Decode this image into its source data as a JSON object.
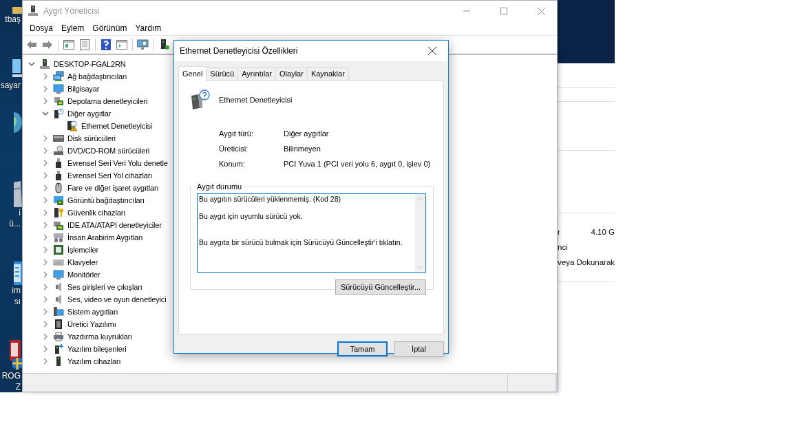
{
  "desktop": {
    "icons": [
      {
        "kind": "folder",
        "lines": [
          "tbaş"
        ]
      },
      {
        "kind": "computer",
        "lines": [
          "sayar"
        ]
      },
      {
        "kind": "globe"
      },
      {
        "kind": "bin",
        "lines": [
          "i",
          "ü..."
        ]
      },
      {
        "kind": "document",
        "lines": [
          "im",
          "sı"
        ]
      },
      {
        "kind": "app",
        "lines": [
          "ROG",
          "Z"
        ]
      }
    ]
  },
  "device_manager": {
    "title": "Aygıt Yöneticisi",
    "menu": [
      "Dosya",
      "Eylem",
      "Görünüm",
      "Yardım"
    ],
    "toolbar": [
      {
        "kind": "back"
      },
      {
        "kind": "forward"
      },
      {
        "kind": "separator"
      },
      {
        "kind": "console"
      },
      {
        "kind": "sheet"
      },
      {
        "kind": "separator"
      },
      {
        "kind": "help"
      },
      {
        "kind": "pane"
      },
      {
        "kind": "separator"
      },
      {
        "kind": "scan"
      },
      {
        "kind": "separator"
      },
      {
        "kind": "add"
      }
    ],
    "tree": [
      {
        "label": "DESKTOP-FGAL2RN",
        "kind": "computer",
        "expanded": true,
        "children": [
          {
            "label": "Ağ bağdaştırıcıları",
            "kind": "network",
            "expanded": false
          },
          {
            "label": "Bilgisayar",
            "kind": "monitor",
            "expanded": false
          },
          {
            "label": "Depolama denetleyicileri",
            "kind": "storage",
            "expanded": false
          },
          {
            "label": "Diğer aygıtlar",
            "kind": "unknown",
            "expanded": true,
            "children": [
              {
                "label": "Ethernet Denetleyicisi",
                "kind": "warning"
              }
            ]
          },
          {
            "label": "Disk sürücüleri",
            "kind": "disk",
            "expanded": false
          },
          {
            "label": "DVD/CD-ROM sürücüleri",
            "kind": "dvd",
            "expanded": false
          },
          {
            "label": "Evrensel Seri Veri Yolu denetle",
            "kind": "usb",
            "expanded": false
          },
          {
            "label": "Evrensel Seri Yol cihazları",
            "kind": "usb",
            "expanded": false
          },
          {
            "label": "Fare ve diğer işaret aygıtları",
            "kind": "mouse",
            "expanded": false
          },
          {
            "label": "Görüntü bağdaştırıcıları",
            "kind": "display",
            "expanded": false
          },
          {
            "label": "Güvenlik cihazları",
            "kind": "security",
            "expanded": false
          },
          {
            "label": "IDE ATA/ATAPI denetleyiciler",
            "kind": "ide",
            "expanded": false
          },
          {
            "label": "İnsan Arabirim Aygıtları",
            "kind": "hid",
            "expanded": false
          },
          {
            "label": "İşlemciler",
            "kind": "cpu",
            "expanded": false
          },
          {
            "label": "Klavyeler",
            "kind": "keyboard",
            "expanded": false
          },
          {
            "label": "Monitörler",
            "kind": "monitor",
            "expanded": false
          },
          {
            "label": "Ses girişleri ve çıkışları",
            "kind": "audio",
            "expanded": false
          },
          {
            "label": "Ses, video ve oyun denetleyici",
            "kind": "audio",
            "expanded": false
          },
          {
            "label": "Sistem aygıtları",
            "kind": "system",
            "expanded": false
          },
          {
            "label": "Üretici Yazılımı",
            "kind": "firmware",
            "expanded": false
          },
          {
            "label": "Yazdırma kuyrukları",
            "kind": "printer",
            "expanded": false
          },
          {
            "label": "Yazılım bileşenleri",
            "kind": "component",
            "expanded": false
          },
          {
            "label": "Yazılım cihazları",
            "kind": "tower",
            "expanded": false
          }
        ]
      }
    ]
  },
  "background_window": {
    "rows": [
      {
        "label": "r",
        "value": "4.10 G"
      },
      {
        "label": "nci"
      },
      {
        "label": "veya Dokunarak"
      }
    ]
  },
  "dialog": {
    "title": "Ethernet Denetleyicisi Özellikleri",
    "tabs": [
      {
        "label": "Genel",
        "selected": true
      },
      {
        "label": "Sürücü",
        "selected": false
      },
      {
        "label": "Ayrıntılar",
        "selected": false
      },
      {
        "label": "Olaylar",
        "selected": false
      },
      {
        "label": "Kaynaklar",
        "selected": false
      }
    ],
    "device_name": "Ethernet Denetleyicisi",
    "properties": [
      {
        "label": "Aygıt türü:",
        "value": "Diğer aygıtlar"
      },
      {
        "label": "Üreticisi:",
        "value": "Bilinmeyen"
      },
      {
        "label": "Konum:",
        "value": "PCI Yuva 1 (PCI veri yolu 6, aygıt 0, işlev 0)"
      }
    ],
    "status_group": "Aygıt durumu",
    "status_text": "Bu aygıtın sürücüleri yüklenmemiş. (Kod 28)\n\nBu aygıt için uyumlu sürücü yok.\n\n\nBu aygıta bir sürücü bulmak için Sürücüyü Güncelleştir'i tıklatın.",
    "update_button": "Sürücüyü Güncelleştir...",
    "buttons": [
      {
        "label": "Tamam",
        "default": true
      },
      {
        "label": "İptal",
        "default": false
      }
    ]
  }
}
